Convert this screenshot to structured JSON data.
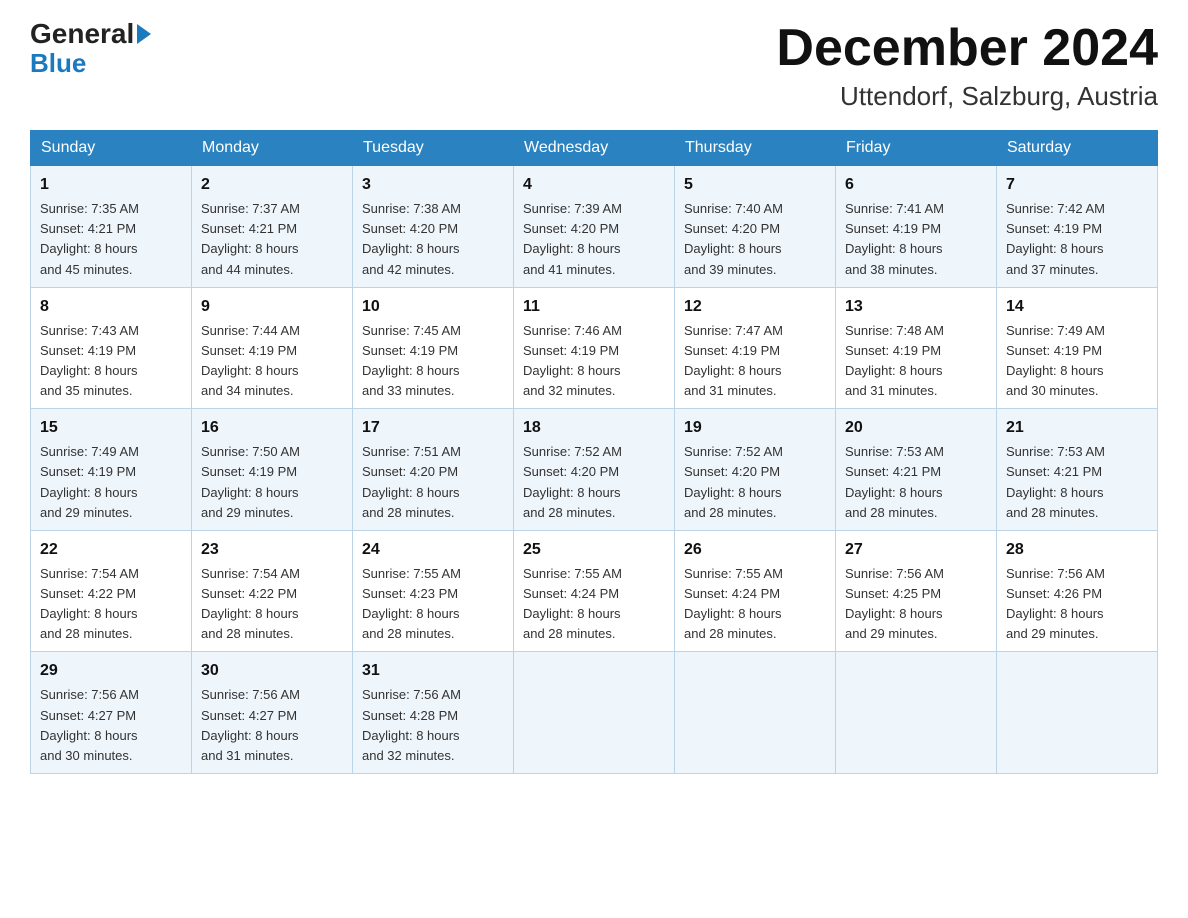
{
  "header": {
    "logo_general": "General",
    "logo_blue": "Blue",
    "month_year": "December 2024",
    "location": "Uttendorf, Salzburg, Austria"
  },
  "days_of_week": [
    "Sunday",
    "Monday",
    "Tuesday",
    "Wednesday",
    "Thursday",
    "Friday",
    "Saturday"
  ],
  "weeks": [
    [
      {
        "day": "1",
        "sunrise": "7:35 AM",
        "sunset": "4:21 PM",
        "daylight": "8 hours and 45 minutes."
      },
      {
        "day": "2",
        "sunrise": "7:37 AM",
        "sunset": "4:21 PM",
        "daylight": "8 hours and 44 minutes."
      },
      {
        "day": "3",
        "sunrise": "7:38 AM",
        "sunset": "4:20 PM",
        "daylight": "8 hours and 42 minutes."
      },
      {
        "day": "4",
        "sunrise": "7:39 AM",
        "sunset": "4:20 PM",
        "daylight": "8 hours and 41 minutes."
      },
      {
        "day": "5",
        "sunrise": "7:40 AM",
        "sunset": "4:20 PM",
        "daylight": "8 hours and 39 minutes."
      },
      {
        "day": "6",
        "sunrise": "7:41 AM",
        "sunset": "4:19 PM",
        "daylight": "8 hours and 38 minutes."
      },
      {
        "day": "7",
        "sunrise": "7:42 AM",
        "sunset": "4:19 PM",
        "daylight": "8 hours and 37 minutes."
      }
    ],
    [
      {
        "day": "8",
        "sunrise": "7:43 AM",
        "sunset": "4:19 PM",
        "daylight": "8 hours and 35 minutes."
      },
      {
        "day": "9",
        "sunrise": "7:44 AM",
        "sunset": "4:19 PM",
        "daylight": "8 hours and 34 minutes."
      },
      {
        "day": "10",
        "sunrise": "7:45 AM",
        "sunset": "4:19 PM",
        "daylight": "8 hours and 33 minutes."
      },
      {
        "day": "11",
        "sunrise": "7:46 AM",
        "sunset": "4:19 PM",
        "daylight": "8 hours and 32 minutes."
      },
      {
        "day": "12",
        "sunrise": "7:47 AM",
        "sunset": "4:19 PM",
        "daylight": "8 hours and 31 minutes."
      },
      {
        "day": "13",
        "sunrise": "7:48 AM",
        "sunset": "4:19 PM",
        "daylight": "8 hours and 31 minutes."
      },
      {
        "day": "14",
        "sunrise": "7:49 AM",
        "sunset": "4:19 PM",
        "daylight": "8 hours and 30 minutes."
      }
    ],
    [
      {
        "day": "15",
        "sunrise": "7:49 AM",
        "sunset": "4:19 PM",
        "daylight": "8 hours and 29 minutes."
      },
      {
        "day": "16",
        "sunrise": "7:50 AM",
        "sunset": "4:19 PM",
        "daylight": "8 hours and 29 minutes."
      },
      {
        "day": "17",
        "sunrise": "7:51 AM",
        "sunset": "4:20 PM",
        "daylight": "8 hours and 28 minutes."
      },
      {
        "day": "18",
        "sunrise": "7:52 AM",
        "sunset": "4:20 PM",
        "daylight": "8 hours and 28 minutes."
      },
      {
        "day": "19",
        "sunrise": "7:52 AM",
        "sunset": "4:20 PM",
        "daylight": "8 hours and 28 minutes."
      },
      {
        "day": "20",
        "sunrise": "7:53 AM",
        "sunset": "4:21 PM",
        "daylight": "8 hours and 28 minutes."
      },
      {
        "day": "21",
        "sunrise": "7:53 AM",
        "sunset": "4:21 PM",
        "daylight": "8 hours and 28 minutes."
      }
    ],
    [
      {
        "day": "22",
        "sunrise": "7:54 AM",
        "sunset": "4:22 PM",
        "daylight": "8 hours and 28 minutes."
      },
      {
        "day": "23",
        "sunrise": "7:54 AM",
        "sunset": "4:22 PM",
        "daylight": "8 hours and 28 minutes."
      },
      {
        "day": "24",
        "sunrise": "7:55 AM",
        "sunset": "4:23 PM",
        "daylight": "8 hours and 28 minutes."
      },
      {
        "day": "25",
        "sunrise": "7:55 AM",
        "sunset": "4:24 PM",
        "daylight": "8 hours and 28 minutes."
      },
      {
        "day": "26",
        "sunrise": "7:55 AM",
        "sunset": "4:24 PM",
        "daylight": "8 hours and 28 minutes."
      },
      {
        "day": "27",
        "sunrise": "7:56 AM",
        "sunset": "4:25 PM",
        "daylight": "8 hours and 29 minutes."
      },
      {
        "day": "28",
        "sunrise": "7:56 AM",
        "sunset": "4:26 PM",
        "daylight": "8 hours and 29 minutes."
      }
    ],
    [
      {
        "day": "29",
        "sunrise": "7:56 AM",
        "sunset": "4:27 PM",
        "daylight": "8 hours and 30 minutes."
      },
      {
        "day": "30",
        "sunrise": "7:56 AM",
        "sunset": "4:27 PM",
        "daylight": "8 hours and 31 minutes."
      },
      {
        "day": "31",
        "sunrise": "7:56 AM",
        "sunset": "4:28 PM",
        "daylight": "8 hours and 32 minutes."
      },
      null,
      null,
      null,
      null
    ]
  ],
  "labels": {
    "sunrise": "Sunrise:",
    "sunset": "Sunset:",
    "daylight": "Daylight:"
  }
}
